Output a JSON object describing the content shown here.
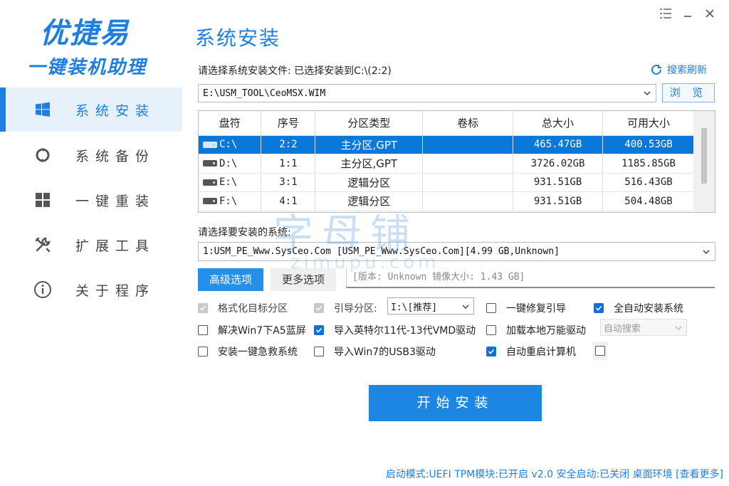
{
  "brand": {
    "title": "优捷易",
    "subtitle": "一键装机助理"
  },
  "sidebar": {
    "items": [
      {
        "label": "系统安装",
        "icon": "windows-icon",
        "active": true
      },
      {
        "label": "系统备份",
        "icon": "backup-icon",
        "active": false
      },
      {
        "label": "一键重装",
        "icon": "grid-icon",
        "active": false
      },
      {
        "label": "扩展工具",
        "icon": "tools-icon",
        "active": false
      },
      {
        "label": "关于程序",
        "icon": "info-icon",
        "active": false
      }
    ]
  },
  "window_controls": [
    "menu-icon",
    "minimize-icon",
    "close-icon"
  ],
  "main": {
    "title": "系统安装",
    "file_label": "请选择系统安装文件: 已选择安装到C:\\(2:2)",
    "refresh_label": "搜索刷新",
    "file_path": "E:\\USM_TOOL\\CeoMSX.WIM",
    "browse_label": "浏 览",
    "table": {
      "headers": [
        "盘符",
        "序号",
        "分区类型",
        "卷标",
        "总大小",
        "可用大小"
      ],
      "rows": [
        {
          "drive": "C:\\",
          "index": "2:2",
          "type": "主分区,GPT",
          "label": "",
          "total": "465.47GB",
          "free": "400.53GB",
          "selected": true
        },
        {
          "drive": "D:\\",
          "index": "1:1",
          "type": "主分区,GPT",
          "label": "",
          "total": "3726.02GB",
          "free": "1185.85GB",
          "selected": false
        },
        {
          "drive": "E:\\",
          "index": "3:1",
          "type": "逻辑分区",
          "label": "",
          "total": "931.51GB",
          "free": "516.43GB",
          "selected": false
        },
        {
          "drive": "F:\\",
          "index": "4:1",
          "type": "逻辑分区",
          "label": "",
          "total": "931.51GB",
          "free": "504.48GB",
          "selected": false
        }
      ]
    },
    "system_label": "请选择要安装的系统:",
    "system_value": "1:USM_PE_Www.SysCeo.Com [USM_PE_Www.SysCeo.Com][4.99 GB,Unknown]",
    "tabs": {
      "advanced": "高级选项",
      "more": "更多选项"
    },
    "image_info": "[版本: Unknown 镜像大小: 1.43 GB]",
    "options": {
      "format_target": "格式化目标分区",
      "boot_partition": "引导分区:",
      "boot_partition_value": "I:\\[推荐]",
      "repair_boot": "一键修复引导",
      "auto_install": "全自动安装系统",
      "fix_win7_blue": "解决Win7下A5蓝屏",
      "import_intel_vmd": "导入英特尔11代-13代VMD驱动",
      "load_local_driver": "加载本地万能驱动",
      "auto_search": "自动搜索",
      "install_rescue": "安装一键急救系统",
      "import_win7_usb3": "导入Win7的USB3驱动",
      "auto_restart": "自动重启计算机"
    },
    "start_label": "开始安装"
  },
  "status_bar": "启动模式:UEFI TPM模块:已开启 v2.0 安全启动:已关闭 桌面环境 [查看更多]",
  "watermark": {
    "main": "字母铺",
    "sub": "zimupu.com"
  },
  "colors": {
    "accent": "#1e7fe0",
    "selected_row": "#0a78d8",
    "button": "#1d86e2"
  }
}
